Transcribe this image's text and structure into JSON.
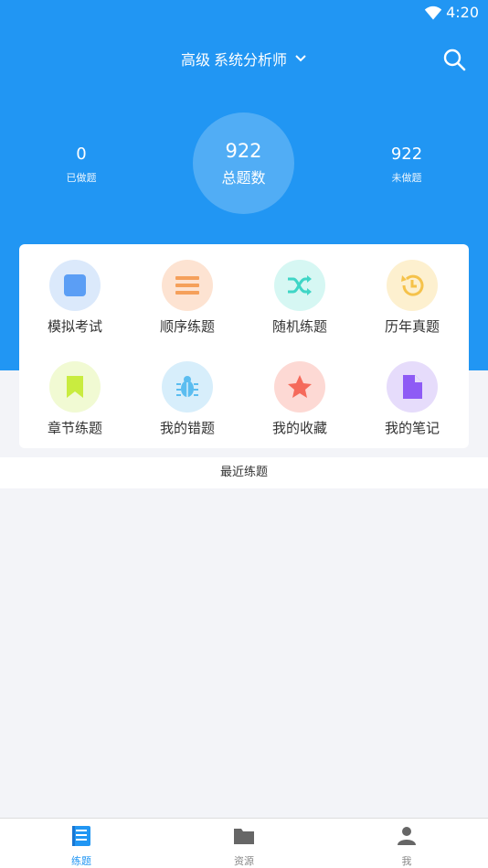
{
  "status_bar": {
    "time": "4:20"
  },
  "header": {
    "exam_level": "高级",
    "exam_name": "系统分析师"
  },
  "stats": {
    "done": {
      "value": "0",
      "label": "已做题"
    },
    "total": {
      "value": "922",
      "label": "总题数"
    },
    "undone": {
      "value": "922",
      "label": "未做题"
    }
  },
  "features": [
    {
      "label": "模拟考试",
      "icon": "square-icon",
      "color": "#5b9ef5",
      "bg": "#dbe9fb"
    },
    {
      "label": "顺序练题",
      "icon": "list-icon",
      "color": "#f5a05b",
      "bg": "#fde3d2"
    },
    {
      "label": "随机练题",
      "icon": "shuffle-icon",
      "color": "#3fd6c6",
      "bg": "#d6f7f3"
    },
    {
      "label": "历年真题",
      "icon": "history-icon",
      "color": "#f5c24a",
      "bg": "#fdf0cf"
    },
    {
      "label": "章节练题",
      "icon": "bookmark-icon",
      "color": "#c9ec3f",
      "bg": "#f1fad3"
    },
    {
      "label": "我的错题",
      "icon": "bug-icon",
      "color": "#5bbdf0",
      "bg": "#d7eefb"
    },
    {
      "label": "我的收藏",
      "icon": "star-icon",
      "color": "#f56a5b",
      "bg": "#fdd9d4"
    },
    {
      "label": "我的笔记",
      "icon": "note-icon",
      "color": "#8e5bf5",
      "bg": "#e6dcfb"
    }
  ],
  "recent": {
    "label": "最近练题"
  },
  "bottom_nav": [
    {
      "label": "练题",
      "icon": "book-icon",
      "active": true
    },
    {
      "label": "资源",
      "icon": "folder-icon",
      "active": false
    },
    {
      "label": "我",
      "icon": "user-icon",
      "active": false
    }
  ],
  "colors": {
    "primary": "#2196f3",
    "background": "#f3f4f8"
  }
}
